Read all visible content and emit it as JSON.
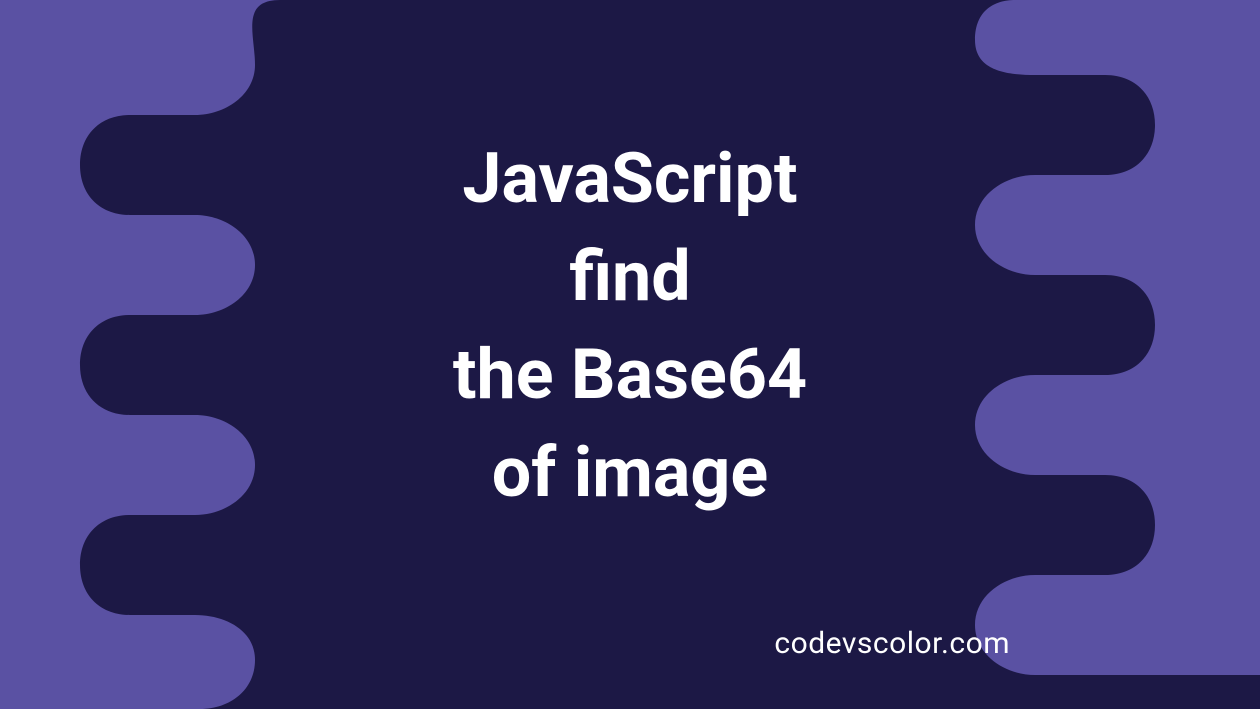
{
  "title": "JavaScript\nfind\nthe Base64\nof image",
  "footer": "codevscolor.com",
  "colors": {
    "background": "#5a51a3",
    "blob": "#1c1845",
    "text": "#ffffff"
  }
}
